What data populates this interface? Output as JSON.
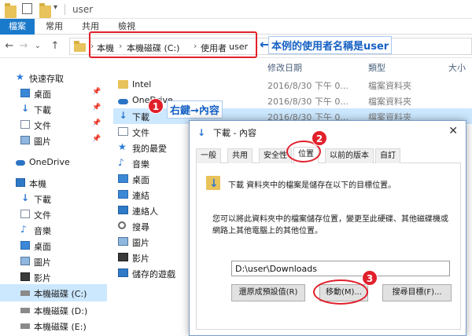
{
  "window": {
    "title": "user"
  },
  "ribbon": {
    "tabs": [
      "檔案",
      "常用",
      "共用",
      "檢視"
    ]
  },
  "nav": {
    "back": "←",
    "forward": "→",
    "down": "⌄",
    "up": "↑"
  },
  "breadcrumb": [
    "本機",
    "本機磁碟 (C:)",
    "使用者",
    "user"
  ],
  "annotation_user": "本例的使用者名稱是user",
  "columns": {
    "modified": "修改日期",
    "type": "類型",
    "size": "大小"
  },
  "sidebar": {
    "quick_access": "快速存取",
    "quick_items": [
      "桌面",
      "下載",
      "文件",
      "圖片"
    ],
    "onedrive": "OneDrive",
    "this_pc": "本機",
    "pc_items": [
      "下載",
      "文件",
      "音樂",
      "桌面",
      "圖片",
      "影片",
      "本機磁碟 (C:)",
      "本機磁碟 (D:)",
      "本機磁碟 (E:)"
    ]
  },
  "files": [
    {
      "name": "Intel",
      "date": "2016/8/30 下午 0...",
      "type": "檔案資料夾"
    },
    {
      "name": "OneDrive",
      "date": "2016/8/30 下午 0...",
      "type": "檔案資料夾"
    },
    {
      "name": "下載",
      "date": "2016/8/30 下午 0...",
      "type": "檔案資料夾"
    },
    {
      "name": "文件",
      "date": "",
      "type": ""
    },
    {
      "name": "我的最愛",
      "date": "",
      "type": ""
    },
    {
      "name": "音樂",
      "date": "",
      "type": ""
    },
    {
      "name": "桌面",
      "date": "",
      "type": ""
    },
    {
      "name": "連結",
      "date": "",
      "type": ""
    },
    {
      "name": "連絡人",
      "date": "",
      "type": ""
    },
    {
      "name": "搜尋",
      "date": "",
      "type": ""
    },
    {
      "name": "圖片",
      "date": "",
      "type": ""
    },
    {
      "name": "影片",
      "date": "",
      "type": ""
    },
    {
      "name": "儲存的遊戲",
      "date": "",
      "type": ""
    }
  ],
  "step1": {
    "num": "1",
    "label": "右鍵→內容"
  },
  "step2": {
    "num": "2"
  },
  "step3": {
    "num": "3"
  },
  "dialog": {
    "title": "下載 - 內容",
    "close": "✕",
    "tabs": [
      "一般",
      "共用",
      "安全性",
      "位置",
      "以前的版本",
      "自訂"
    ],
    "desc": "下載 資料夾中的檔案是儲存在以下的目標位置。",
    "help": "您可以將此資料夾中的檔案儲存位置，變更至此硬碟、其他磁碟機或網路上其他電腦上的其他位置。",
    "path": "D:\\user\\Downloads",
    "buttons": {
      "restore": "還原成預設值(R)",
      "move": "移動(M)...",
      "find": "搜尋目標(F)..."
    }
  }
}
